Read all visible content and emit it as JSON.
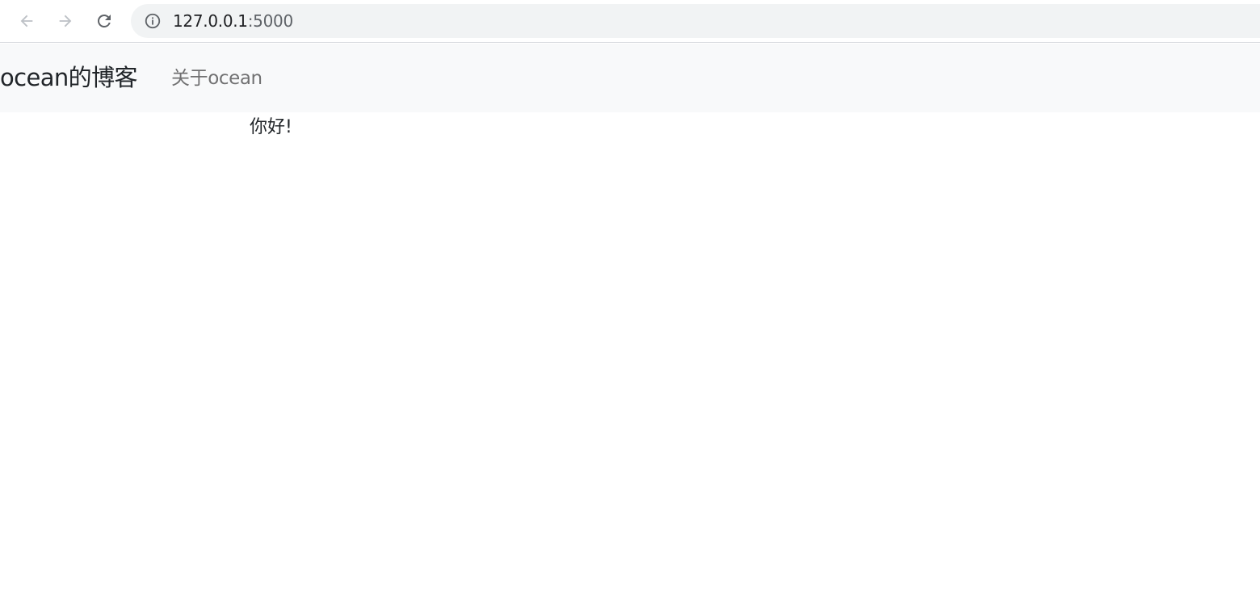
{
  "browser": {
    "url_host": "127.0.0.1",
    "url_port": ":5000",
    "icons": {
      "back": "arrow-left-icon",
      "forward": "arrow-right-icon",
      "reload": "reload-icon",
      "site_info": "info-circle-icon"
    }
  },
  "navbar": {
    "brand": "ocean的博客",
    "links": [
      {
        "label": "关于ocean"
      }
    ]
  },
  "main": {
    "greeting": "你好!"
  },
  "colors": {
    "navbar_bg": "#f8f9fa",
    "omnibox_bg": "#f1f3f4",
    "text": "#212529",
    "nav_link": "#6c6c6c"
  }
}
